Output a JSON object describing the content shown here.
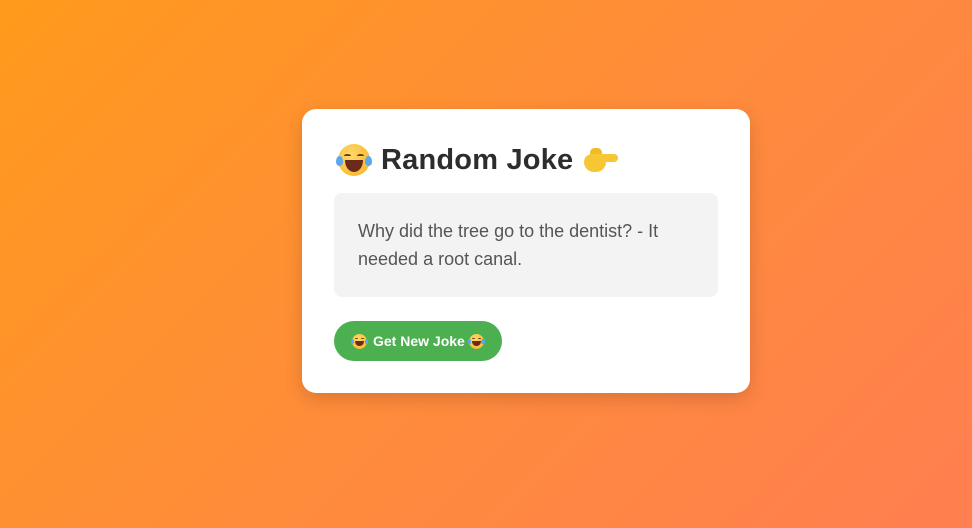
{
  "card": {
    "title": "Random Joke",
    "title_left_icon": "laughing-tears-emoji-icon",
    "title_right_icon": "pointing-hand-emoji-icon",
    "joke_text": "Why did the tree go to the dentist? - It needed a root canal.",
    "button": {
      "label": "Get New Joke",
      "left_icon": "laughing-tears-emoji-icon",
      "right_icon": "laughing-tears-emoji-icon"
    }
  },
  "colors": {
    "background_start": "#ff9a1c",
    "background_end": "#ff7f50",
    "card": "#ffffff",
    "joke_box": "#f3f3f3",
    "button": "#4caf50",
    "title_text": "#2d2d2d",
    "joke_text": "#555555"
  }
}
